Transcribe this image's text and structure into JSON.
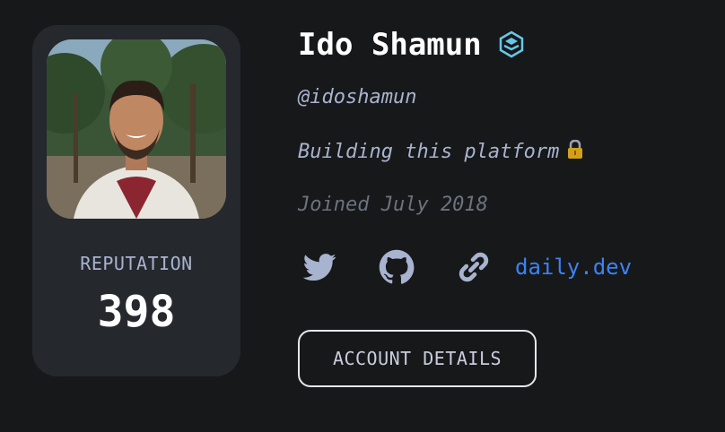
{
  "profile": {
    "name": "Ido Shamun",
    "handle": "@idoshamun",
    "bio": "Building this platform",
    "joined": "Joined July 2018",
    "badge_icon": "rank-badge-icon",
    "bio_emoji_icon": "locked-lock-emoji-icon"
  },
  "reputation": {
    "label": "REPUTATION",
    "value": "398"
  },
  "links": {
    "icons": [
      "twitter-icon",
      "github-icon",
      "link-icon"
    ],
    "site_label": "daily.dev"
  },
  "actions": {
    "account_details_label": "ACCOUNT DETAILS"
  },
  "colors": {
    "background": "#171819",
    "card": "#25282d",
    "muted_text": "#a8b3cf",
    "link": "#3b82f6",
    "badge": "#67c7e8"
  }
}
